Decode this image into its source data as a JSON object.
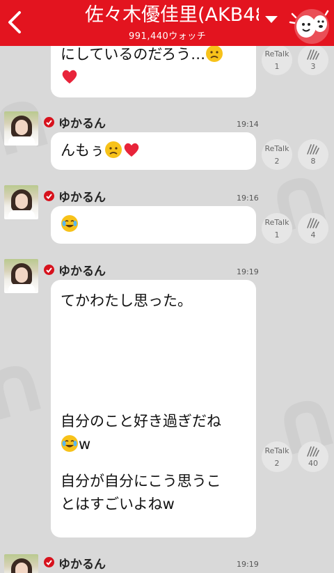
{
  "header": {
    "title": "佐々木優佳里(AKB48",
    "watch_count": "991,440ウォッチ"
  },
  "actions_label": "ReTalk",
  "partial_message": {
    "text": "にしているのだろう…",
    "retalk_count": "1",
    "clap_count": "3"
  },
  "messages": [
    {
      "user": "ゆかるん",
      "time": "19:14",
      "text": "んもぅ",
      "retalk_count": "2",
      "clap_count": "8"
    },
    {
      "user": "ゆかるん",
      "time": "19:16",
      "text": "",
      "retalk_count": "1",
      "clap_count": "4"
    },
    {
      "user": "ゆかるん",
      "time": "19:19",
      "lines": [
        "てかわたし思った。",
        "自分のこと好き過ぎだね",
        "w",
        "自分が自分にこう思うこ",
        "とはすごいよねw"
      ],
      "retalk_count": "2",
      "clap_count": "40"
    },
    {
      "user": "ゆかるん",
      "time": "19:19"
    }
  ],
  "colors": {
    "header": "#e3141f",
    "background": "#d9d9d9",
    "bubble": "#ffffff"
  },
  "icons": [
    "back-arrow-icon",
    "dropdown-caret-icon",
    "mascot-icon",
    "verified-badge-icon",
    "clap-icon",
    "sad-face-emoji",
    "heart-emoji",
    "tears-of-joy-emoji"
  ]
}
